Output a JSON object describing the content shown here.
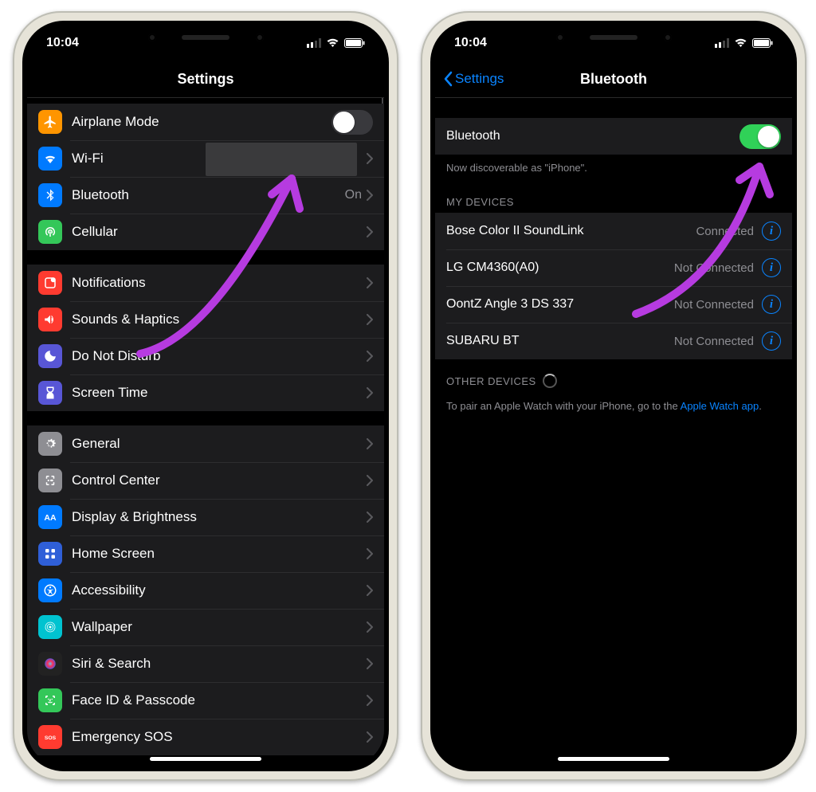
{
  "statusbar": {
    "time": "10:04"
  },
  "left": {
    "title": "Settings",
    "group1": [
      {
        "icon": "airplane",
        "color": "#ff9500",
        "label": "Airplane Mode",
        "kind": "toggle",
        "on": false
      },
      {
        "icon": "wifi",
        "color": "#007aff",
        "label": "Wi-Fi",
        "kind": "value-nav",
        "value": ""
      },
      {
        "icon": "bluetooth",
        "color": "#007aff",
        "label": "Bluetooth",
        "kind": "value-nav",
        "value": "On"
      },
      {
        "icon": "cellular",
        "color": "#34c759",
        "label": "Cellular",
        "kind": "nav"
      }
    ],
    "group2": [
      {
        "icon": "notifications",
        "color": "#ff3b30",
        "label": "Notifications"
      },
      {
        "icon": "sounds",
        "color": "#ff3b30",
        "label": "Sounds & Haptics"
      },
      {
        "icon": "dnd",
        "color": "#5856d6",
        "label": "Do Not Disturb"
      },
      {
        "icon": "screentime",
        "color": "#5856d6",
        "label": "Screen Time"
      }
    ],
    "group3": [
      {
        "icon": "general",
        "color": "#8e8e93",
        "label": "General"
      },
      {
        "icon": "control",
        "color": "#8e8e93",
        "label": "Control Center"
      },
      {
        "icon": "display",
        "color": "#007aff",
        "label": "Display & Brightness"
      },
      {
        "icon": "home",
        "color": "#2f5fd8",
        "label": "Home Screen"
      },
      {
        "icon": "accessibility",
        "color": "#007aff",
        "label": "Accessibility"
      },
      {
        "icon": "wallpaper",
        "color": "#00c3d0",
        "label": "Wallpaper"
      },
      {
        "icon": "siri",
        "color": "#222",
        "label": "Siri & Search"
      },
      {
        "icon": "faceid",
        "color": "#34c759",
        "label": "Face ID & Passcode"
      },
      {
        "icon": "sos",
        "color": "#ff3b30",
        "label": "Emergency SOS"
      }
    ]
  },
  "right": {
    "back": "Settings",
    "title": "Bluetooth",
    "toggle": {
      "label": "Bluetooth",
      "on": true
    },
    "discoverable": "Now discoverable as \"iPhone\".",
    "my_devices_header": "MY DEVICES",
    "devices": [
      {
        "name": "Bose Color II SoundLink",
        "status": "Connected"
      },
      {
        "name": "LG CM4360(A0)",
        "status": "Not Connected"
      },
      {
        "name": "OontZ Angle 3 DS 337",
        "status": "Not Connected"
      },
      {
        "name": "SUBARU BT",
        "status": "Not Connected"
      }
    ],
    "other_devices_header": "OTHER DEVICES",
    "pair_note_prefix": "To pair an Apple Watch with your iPhone, go to the ",
    "pair_note_link": "Apple Watch app",
    "pair_note_suffix": "."
  },
  "annotation": {
    "color": "#b63be0"
  }
}
